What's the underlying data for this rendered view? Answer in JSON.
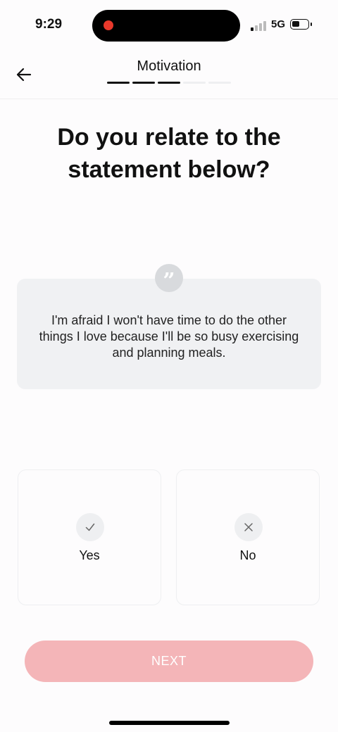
{
  "status_bar": {
    "time": "9:29",
    "network": "5G",
    "recording_color": "#e8382b"
  },
  "header": {
    "back_icon": "arrow-left-icon",
    "title": "Motivation",
    "progress": {
      "total_steps": 5,
      "completed_steps": 3
    }
  },
  "question": "Do you relate to the statement below?",
  "statement": {
    "icon": "quote-icon",
    "text": "I'm afraid I won't have time to do the other things I love because I'll be so busy exercising and planning meals."
  },
  "options": [
    {
      "icon": "checkmark-icon",
      "label": "Yes"
    },
    {
      "icon": "close-icon",
      "label": "No"
    }
  ],
  "next_button": {
    "label": "NEXT",
    "color": "#f4b5b8"
  },
  "colors": {
    "background": "#fdfcfd",
    "card": "#f0f1f3",
    "progress_active": "#111111",
    "progress_inactive": "#eeeff1"
  }
}
